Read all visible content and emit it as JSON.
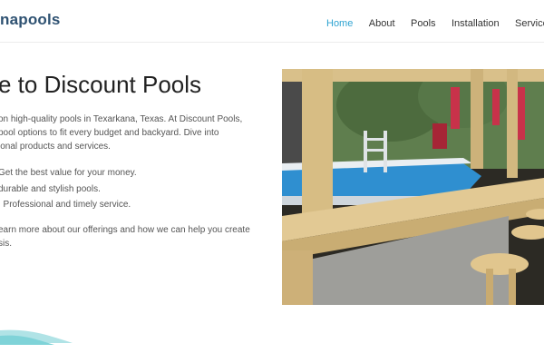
{
  "brand": {
    "logo_text": "napools"
  },
  "nav": {
    "items": [
      {
        "label": "Home",
        "active": true
      },
      {
        "label": "About",
        "active": false
      },
      {
        "label": "Pools",
        "active": false
      },
      {
        "label": "Installation",
        "active": false
      },
      {
        "label": "Services",
        "active": false
      }
    ]
  },
  "hero": {
    "title": "e to Discount Pools",
    "intro_lines": [
      "on high-quality pools in Texarkana, Texas. At Discount Pools,",
      " pool options to fit every budget and backyard. Dive into",
      "ional products and services."
    ],
    "features": [
      "Get the best value for your money.",
      "durable and stylish pools.",
      ": Professional and timely service."
    ],
    "outro_lines": [
      "earn more about our offerings and how we can help you create",
      "sis."
    ]
  },
  "image": {
    "subject": "above-ground pool with wooden deck bar and stools"
  },
  "colors": {
    "accent": "#2ea3d1",
    "logo": "#2f5272",
    "wave": "#7fd3d8"
  }
}
